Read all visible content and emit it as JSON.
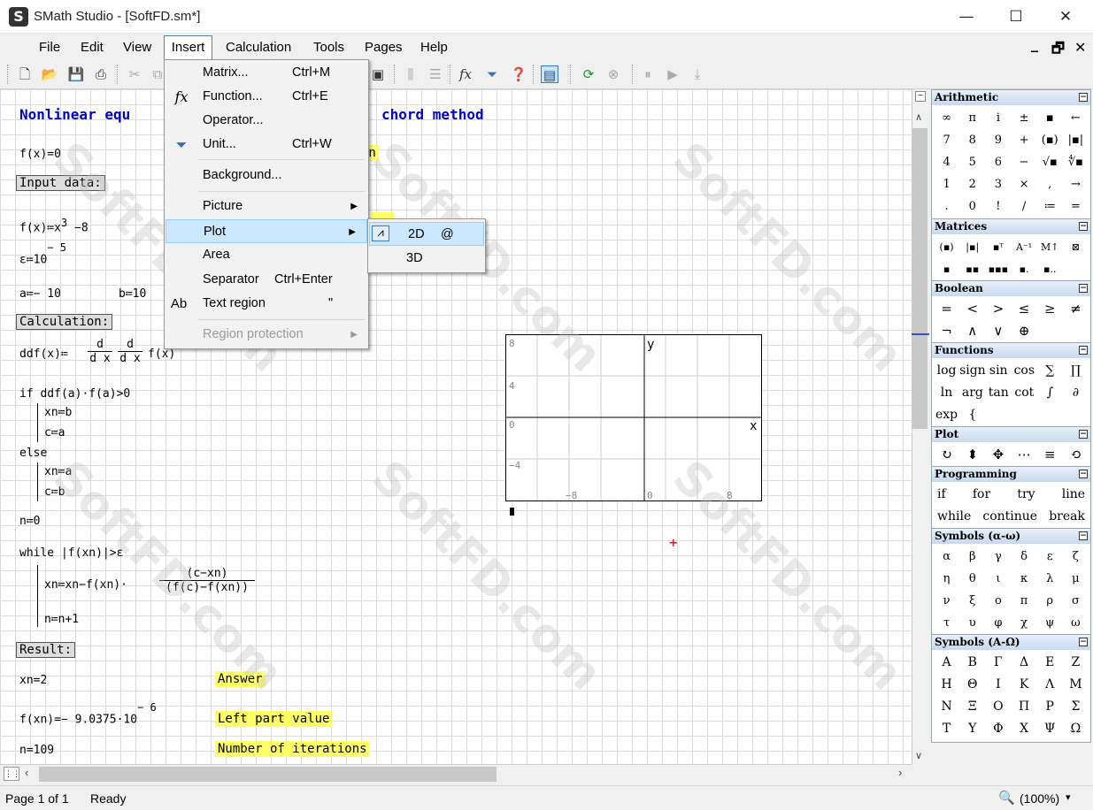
{
  "window": {
    "app_name": "SMath Studio",
    "document": "[SoftFD.sm*]",
    "title": "SMath Studio - [SoftFD.sm*]",
    "icon_letter": "S",
    "minimize": "—",
    "maximize": "☐",
    "close": "✕"
  },
  "menubar": {
    "items": [
      "File",
      "Edit",
      "View",
      "Insert",
      "Calculation",
      "Tools",
      "Pages",
      "Help"
    ],
    "mdi_minimize": "_",
    "mdi_restore": "🗗",
    "mdi_close": "✕"
  },
  "insert_menu": {
    "matrix": {
      "label": "Matrix...",
      "shortcut": "Ctrl+M"
    },
    "function": {
      "label": "Function...",
      "shortcut": "Ctrl+E",
      "icon": "fx"
    },
    "operator": {
      "label": "Operator..."
    },
    "unit": {
      "label": "Unit...",
      "shortcut": "Ctrl+W"
    },
    "background": {
      "label": "Background..."
    },
    "picture": {
      "label": "Picture"
    },
    "plot": {
      "label": "Plot"
    },
    "area": {
      "label": "Area"
    },
    "separator": {
      "label": "Separator",
      "shortcut": "Ctrl+Enter"
    },
    "text_region": {
      "label": "Text region",
      "shortcut": "\"",
      "icon": "Ab"
    },
    "region_protection": {
      "label": "Region protection"
    }
  },
  "plot_submenu": {
    "items": [
      {
        "label": "2D",
        "shortcut": "@"
      },
      {
        "label": "3D",
        "shortcut": ""
      }
    ]
  },
  "worksheet": {
    "heading_left": "Nonlinear equ",
    "heading_right": "chord method",
    "f_eq": "f(x)=0",
    "partial_hl": "on",
    "input_label": "Input data:",
    "f_def": "f(x)≔x",
    "f_exp": "3",
    "f_tail": "−8",
    "eps_def": "ε≔10",
    "eps_exp": "− 5",
    "a_def": "a≔− 10",
    "b_def": "b≔10",
    "calc_label": "Calculation:",
    "ddf_lhs": "ddf(x)≔",
    "d": "d",
    "dx": "d x",
    "ddf_tail": "f(x)",
    "if_line": "if  ddf(a)·f(a)>0",
    "xn_b": "xn≔b",
    "c_a": "c≔a",
    "else": "else",
    "xn_a": "xn≔a",
    "c_b": "c≔b",
    "n0": "n≔0",
    "while_line": "while  |f(xn)|>ε",
    "xn_upd": "xn≔xn−f(xn)·",
    "frac_num": "(c−xn)",
    "frac_den": "(f(c)−f(xn))",
    "n_upd": "n≔n+1",
    "result_label": "Result:",
    "xn_res": "xn=2",
    "answer": "Answer",
    "fxn_res": "f(xn)=− 9.0375·10",
    "fxn_exp": "− 6",
    "left_part": "Left part value",
    "n_res": "n=109",
    "iterations": "Number of iterations",
    "watermark": "SoftFD.com"
  },
  "plot": {
    "y_ticks": [
      "8",
      "4",
      "0",
      "−4"
    ],
    "x_ticks": [
      "−8",
      "0",
      "8"
    ],
    "x_axis": "x",
    "y_axis": "y"
  },
  "statusbar": {
    "page": "Page 1 of 1",
    "status": "Ready",
    "zoom": "(100%)",
    "zoom_arrow": "▾"
  },
  "panel": {
    "arithmetic": {
      "title": "Arithmetic",
      "rows": [
        [
          "∞",
          "π",
          "i",
          "±",
          "▪",
          "←"
        ],
        [
          "7",
          "8",
          "9",
          "+",
          "(▪)",
          "|▪|"
        ],
        [
          "4",
          "5",
          "6",
          "−",
          "√▪",
          "∜▪"
        ],
        [
          "1",
          "2",
          "3",
          "×",
          ",",
          "→"
        ],
        [
          ".",
          "0",
          "!",
          "/",
          "≔",
          "="
        ]
      ]
    },
    "matrices": {
      "title": "Matrices",
      "rows": [
        [
          "(▪)",
          "|▪|",
          "▪ᵀ",
          "A⁻¹",
          "M↑",
          "⊠"
        ],
        [
          "▪",
          "▪▪",
          "▪▪▪",
          "▪.",
          "▪.."
        ]
      ]
    },
    "boolean": {
      "title": "Boolean",
      "rows": [
        [
          "=",
          "<",
          ">",
          "≤",
          "≥",
          "≠"
        ],
        [
          "¬",
          "∧",
          "∨",
          "⊕"
        ]
      ]
    },
    "functions": {
      "title": "Functions",
      "rows": [
        [
          "log",
          "sign",
          "sin",
          "cos",
          "∑",
          "∏"
        ],
        [
          "ln",
          "arg",
          "tan",
          "cot",
          "∫",
          "∂"
        ],
        [
          "exp",
          "{"
        ]
      ]
    },
    "plot": {
      "title": "Plot",
      "rows": [
        [
          "↻",
          "⬍",
          "✥",
          "⋯",
          "≡",
          "⟲"
        ]
      ]
    },
    "programming": {
      "title": "Programming",
      "rows": [
        [
          "if",
          "for",
          "try",
          "line"
        ],
        [
          "while",
          "continue",
          "break"
        ]
      ]
    },
    "greek_lower": {
      "title": "Symbols (α-ω)",
      "rows": [
        [
          "α",
          "β",
          "γ",
          "δ",
          "ε",
          "ζ"
        ],
        [
          "η",
          "θ",
          "ι",
          "κ",
          "λ",
          "μ"
        ],
        [
          "ν",
          "ξ",
          "ο",
          "π",
          "ρ",
          "σ"
        ],
        [
          "τ",
          "υ",
          "φ",
          "χ",
          "ψ",
          "ω"
        ]
      ]
    },
    "greek_upper": {
      "title": "Symbols (A-Ω)",
      "rows": [
        [
          "Α",
          "Β",
          "Γ",
          "Δ",
          "Ε",
          "Ζ"
        ],
        [
          "Η",
          "Θ",
          "Ι",
          "Κ",
          "Λ",
          "Μ"
        ],
        [
          "Ν",
          "Ξ",
          "Ο",
          "Π",
          "Ρ",
          "Σ"
        ],
        [
          "Τ",
          "Υ",
          "Φ",
          "Χ",
          "Ψ",
          "Ω"
        ]
      ]
    }
  },
  "icons": {
    "new": "new-file-icon",
    "open": "open-folder-icon",
    "save": "save-icon",
    "print": "print-icon",
    "cut": "cut-icon",
    "recalc": "recalculate-icon",
    "stop": "stop-icon",
    "zoom": "magnifier-icon"
  },
  "colors": {
    "heading": "#0000cc",
    "highlight": "#ffff66",
    "menu_hover": "#cce8ff"
  }
}
